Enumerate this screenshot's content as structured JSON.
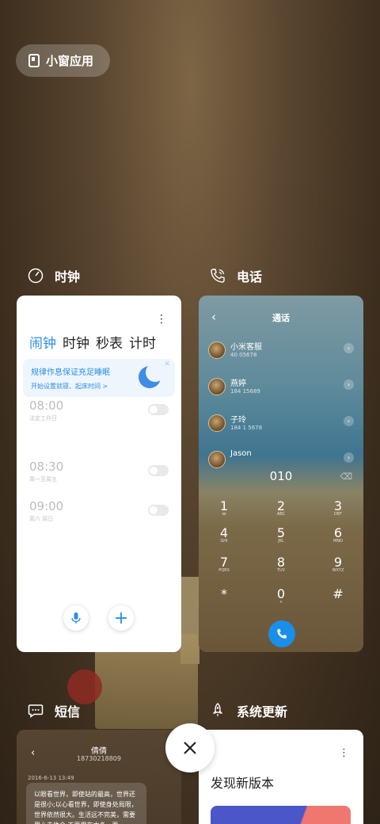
{
  "floating_window": {
    "label": "小窗应用"
  },
  "apps": {
    "clock": {
      "label": "时钟",
      "tabs": [
        "闹钟",
        "时钟",
        "秒表",
        "计时"
      ],
      "banner_title": "规律作息保证充足睡眠",
      "banner_sub": "开始设置就寝、起床时间 >",
      "alarms": [
        {
          "time": "08:00",
          "sub": "法定工作日"
        },
        {
          "time": "08:30",
          "sub": "周一至周五"
        },
        {
          "time": "09:00",
          "sub": "周六 周日"
        }
      ]
    },
    "phone": {
      "label": "电话",
      "title": "通话",
      "contacts": [
        {
          "name": "小米客服",
          "number": "40 05678"
        },
        {
          "name": "燕婷",
          "number": "184 15689"
        },
        {
          "name": "子玲",
          "number": "184 1 5678"
        },
        {
          "name": "Jason",
          "number": ""
        }
      ],
      "dial_input": "010",
      "keys": [
        {
          "digit": "1",
          "letters": "ꝏ"
        },
        {
          "digit": "2",
          "letters": "ABC"
        },
        {
          "digit": "3",
          "letters": "DEF"
        },
        {
          "digit": "4",
          "letters": "GHI"
        },
        {
          "digit": "5",
          "letters": "JKL"
        },
        {
          "digit": "6",
          "letters": "MNO"
        },
        {
          "digit": "7",
          "letters": "PQRS"
        },
        {
          "digit": "8",
          "letters": "TUV"
        },
        {
          "digit": "9",
          "letters": "WXYZ"
        },
        {
          "digit": "*",
          "letters": ""
        },
        {
          "digit": "0",
          "letters": "+"
        },
        {
          "digit": "#",
          "letters": ""
        }
      ]
    },
    "sms": {
      "label": "短信",
      "contact_name": "倩倩",
      "contact_phone": "18730218809",
      "date": "2016-6-13 13:49",
      "message": "以眼看世界，即使站的最高，世界还是很小;以心看世界，即使身处局限，世界依然很大。生活远不完美，需要用心去体会,不要用在太多，要"
    },
    "updater": {
      "label": "系统更新",
      "title": "发现新版本"
    }
  },
  "colors": {
    "accent": "#2d8fe3",
    "call": "#1a8fe9"
  }
}
